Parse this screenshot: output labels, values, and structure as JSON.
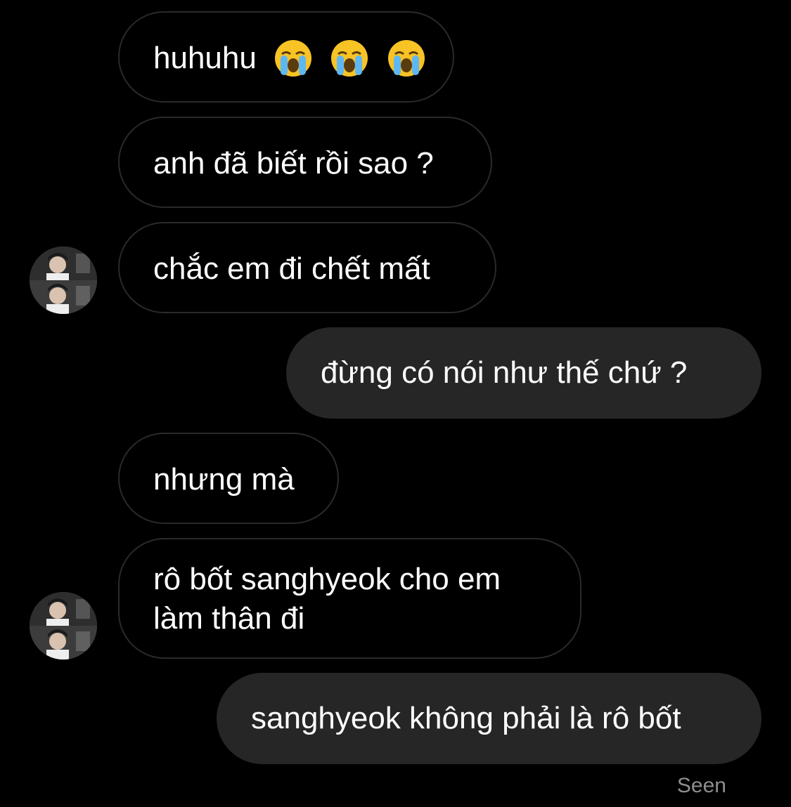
{
  "messages": [
    {
      "direction": "incoming",
      "text": "huhuhu",
      "emojis": [
        "loudly-crying-face-icon",
        "loudly-crying-face-icon",
        "loudly-crying-face-icon"
      ]
    },
    {
      "direction": "incoming",
      "text": "anh đã biết rồi sao ?"
    },
    {
      "direction": "incoming",
      "text": "chắc em đi chết mất",
      "avatar": "sender-avatar"
    },
    {
      "direction": "outgoing",
      "text": "đừng có nói như thế chứ ?"
    },
    {
      "direction": "incoming",
      "text": "nhưng mà"
    },
    {
      "direction": "incoming",
      "text_lines": [
        "rô bốt sanghyeok cho em",
        "làm thân đi"
      ],
      "avatar": "sender-avatar"
    },
    {
      "direction": "outgoing",
      "text": "sanghyeok không phải là rô bốt"
    }
  ],
  "status": {
    "seen_label": "Seen"
  },
  "colors": {
    "background": "#000000",
    "incoming_border": "#2a2a2a",
    "outgoing_bubble": "#262626",
    "text": "#ffffff",
    "seen_text": "#8e8e8e",
    "emoji_face": "#f7c325"
  }
}
